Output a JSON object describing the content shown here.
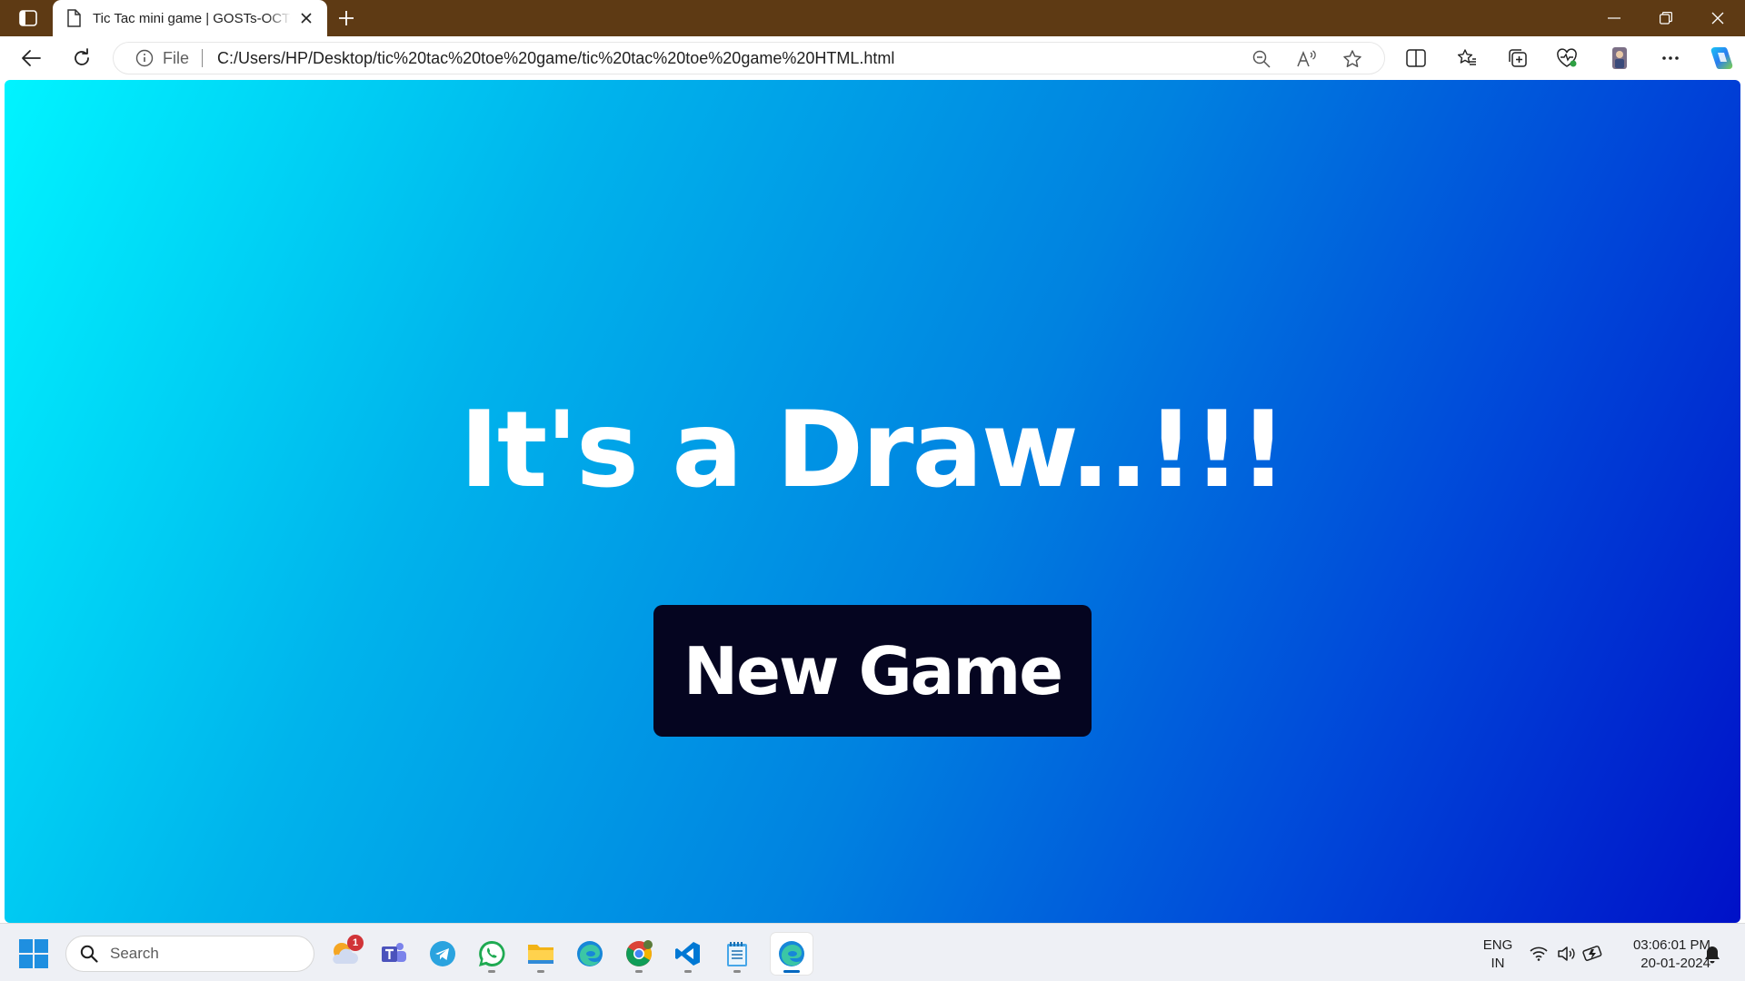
{
  "browser": {
    "tab_title": "Tic Tac mini game | GOSTs-OCTO",
    "address": {
      "scheme_label": "File",
      "url": "C:/Users/HP/Desktop/tic%20tac%20toe%20game/tic%20tac%20toe%20game%20HTML.html"
    }
  },
  "page": {
    "result_message": "It's a Draw..!!!",
    "new_game_label": "New Game",
    "colors": {
      "gradient_start": "#00f4ff",
      "gradient_end": "#0011c8",
      "button_bg": "#050520"
    }
  },
  "taskbar": {
    "search_placeholder": "Search",
    "apps": [
      {
        "name": "weather-widget",
        "badge": "1"
      },
      {
        "name": "teams"
      },
      {
        "name": "telegram"
      },
      {
        "name": "whatsapp"
      },
      {
        "name": "file-explorer"
      },
      {
        "name": "edge"
      },
      {
        "name": "chrome"
      },
      {
        "name": "vs-code"
      },
      {
        "name": "notepad"
      },
      {
        "name": "edge-active"
      }
    ],
    "language": {
      "line1": "ENG",
      "line2": "IN"
    },
    "clock": {
      "time": "03:06:01 PM",
      "date": "20-01-2024"
    }
  }
}
